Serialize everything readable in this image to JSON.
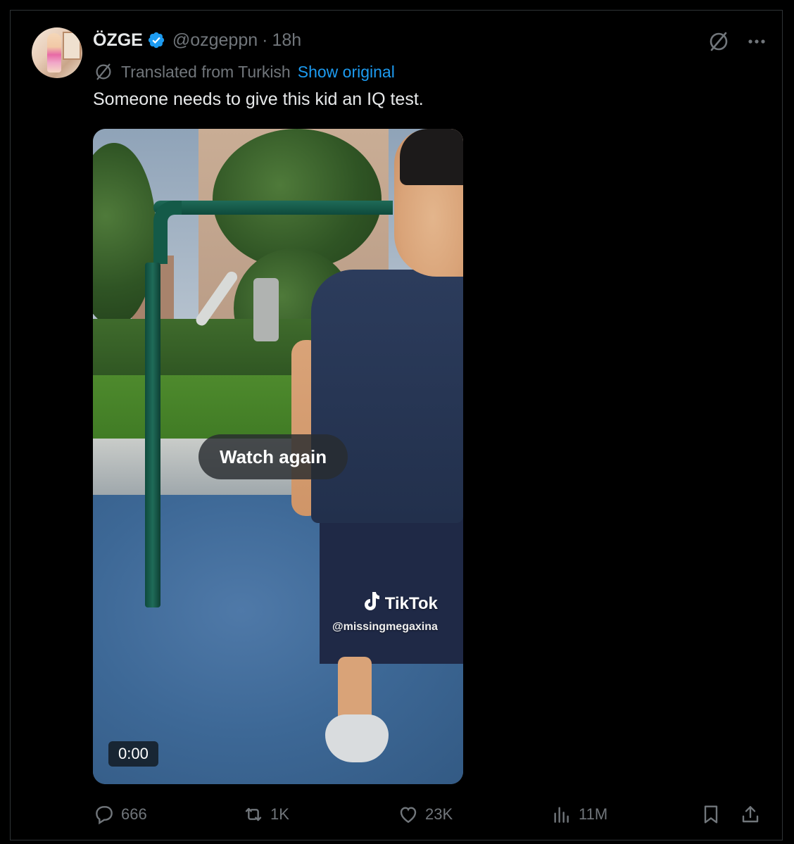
{
  "post": {
    "author_name": "ÖZGE",
    "author_handle": "@ozgeppn",
    "separator": "·",
    "time_ago": "18h",
    "translated_label": "Translated from Turkish",
    "show_original": "Show original",
    "text": "Someone needs to give this kid an IQ test."
  },
  "video": {
    "watch_again": "Watch again",
    "brand": "TikTok",
    "tiktok_user": "@missingmegaxina",
    "timestamp": "0:00"
  },
  "actions": {
    "replies": "666",
    "reposts": "1K",
    "likes": "23K",
    "views": "11M"
  },
  "icons": {
    "verified": "verified-badge-icon",
    "grok": "grok-icon",
    "more": "more-icon",
    "reply": "reply-icon",
    "repost": "repost-icon",
    "like": "like-icon",
    "views": "views-icon",
    "bookmark": "bookmark-icon",
    "share": "share-icon"
  },
  "colors": {
    "background": "#000000",
    "text_primary": "#e7e9ea",
    "text_secondary": "#71767b",
    "link": "#1d9bf0",
    "verified": "#1d9bf0"
  }
}
